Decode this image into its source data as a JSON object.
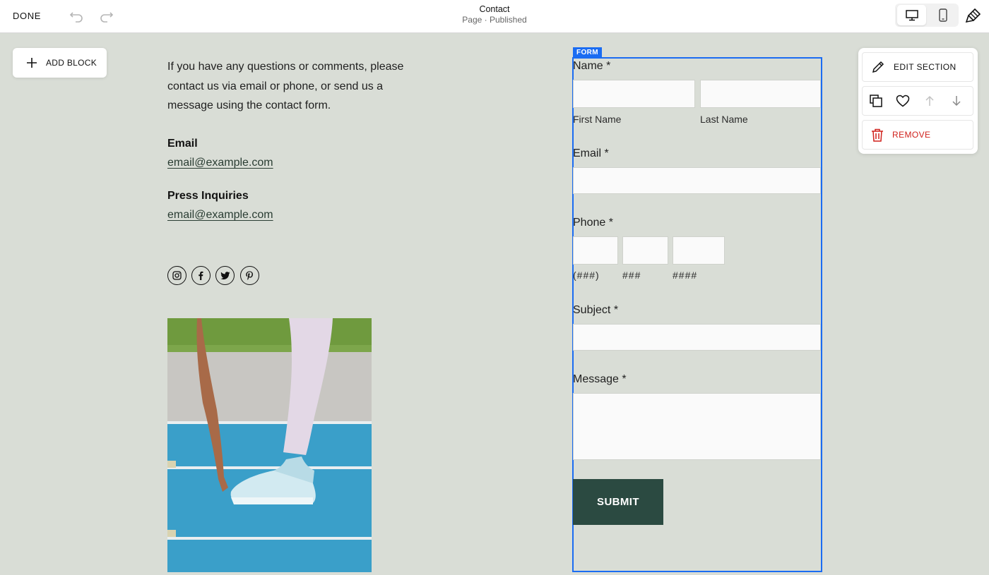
{
  "toolbar": {
    "done_label": "DONE",
    "page_title": "Contact",
    "page_status": "Page · Published"
  },
  "add_block": {
    "label": "ADD BLOCK"
  },
  "content": {
    "intro": "If you have any questions or comments, please contact us via email or phone, or send us a message using the contact form.",
    "email_heading": "Email",
    "email_link": "email@example.com",
    "press_heading": "Press Inquiries",
    "press_link": "email@example.com",
    "social_icons": [
      "instagram-icon",
      "facebook-icon",
      "twitter-icon",
      "pinterest-icon"
    ]
  },
  "form": {
    "tag": "FORM",
    "name_label": "Name *",
    "first_name_label": "First Name",
    "last_name_label": "Last Name",
    "email_label": "Email *",
    "phone_label": "Phone *",
    "phone_area_label": "(###)",
    "phone_prefix_label": "###",
    "phone_line_label": "####",
    "subject_label": "Subject *",
    "message_label": "Message *",
    "submit_label": "SUBMIT"
  },
  "section_panel": {
    "edit_label": "EDIT SECTION",
    "remove_label": "REMOVE"
  },
  "colors": {
    "page_bg": "#d9ddd6",
    "accent_blue": "#1b6cf2",
    "submit_bg": "#2b4a41",
    "remove_red": "#d0211c"
  }
}
